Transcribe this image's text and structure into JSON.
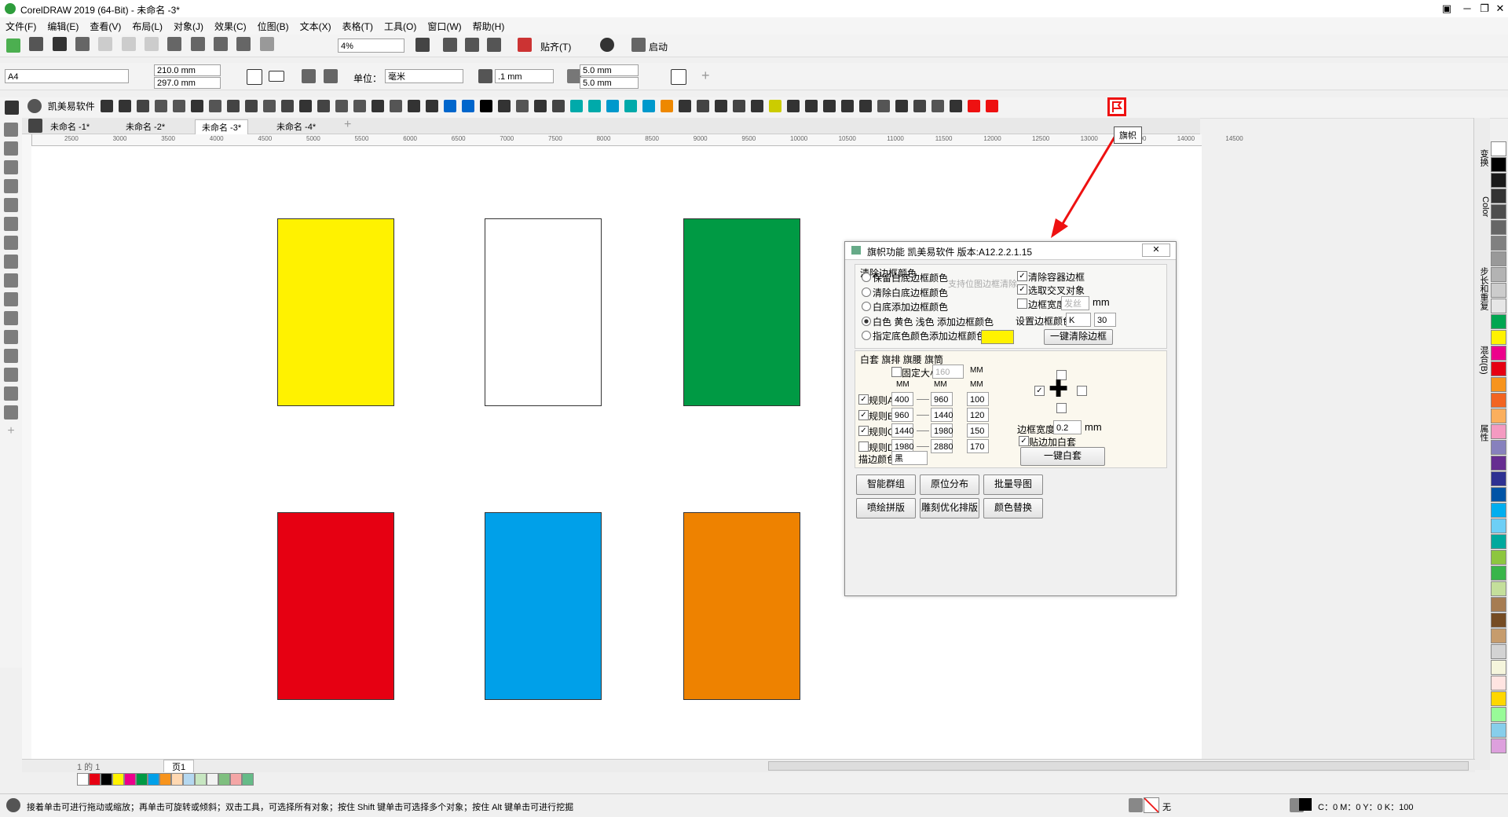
{
  "window": {
    "title": "CorelDRAW 2019 (64-Bit) - 未命名 -3*"
  },
  "menu": [
    "文件(F)",
    "编辑(E)",
    "查看(V)",
    "布局(L)",
    "对象(J)",
    "效果(C)",
    "位图(B)",
    "文本(X)",
    "表格(T)",
    "工具(O)",
    "窗口(W)",
    "帮助(H)"
  ],
  "toolbar1": {
    "zoom": "4%",
    "snap": "贴齐(T)",
    "launch": "启动"
  },
  "propbar": {
    "page_size": "A4",
    "width": "210.0 mm",
    "height": "297.0 mm",
    "unit_label": "单位：",
    "unit": "毫米",
    "nudge": ".1 mm",
    "dup_x": "5.0 mm",
    "dup_y": "5.0 mm"
  },
  "plugin_bar": {
    "brand": "凯美易软件",
    "tooltip": "旗帜"
  },
  "tabs": [
    "未命名 -1*",
    "未命名 -2*",
    "未命名 -3*",
    "未命名 -4*"
  ],
  "ruler_h": [
    "2500",
    "3000",
    "3500",
    "4000",
    "4500",
    "5000",
    "5500",
    "6000",
    "6500",
    "7000",
    "7500",
    "8000",
    "8500",
    "9000",
    "9500",
    "10000",
    "10500",
    "11000",
    "11500",
    "12000",
    "12500",
    "13000",
    "13500",
    "14000",
    "14500"
  ],
  "shapes": [
    {
      "color": "#fff200"
    },
    {
      "color": "#ffffff"
    },
    {
      "color": "#009a44"
    },
    {
      "color": "#e60012"
    },
    {
      "color": "#00a0e9"
    },
    {
      "color": "#ee8200"
    }
  ],
  "dialog": {
    "title": "旗帜功能  凯美易软件  版本:A12.2.2.1.15",
    "close": "✕",
    "group1_title": "清除边框颜色",
    "radio_options": [
      "保留白底边框颜色",
      "清除白底边框颜色",
      "白底添加边框颜色",
      "白色 黄色 浅色 添加边框颜色",
      "指定底色颜色添加边框颜色"
    ],
    "hint": "支持位图边框清除",
    "chk_clear_container": "清除容器边框",
    "chk_select_cross": "选取交叉对象",
    "chk_border_width": "边框宽度",
    "border_width_val": "发丝",
    "mm": "mm",
    "set_border_color": "设置边框颜色",
    "border_color_val": "K",
    "border_color_num": "30",
    "one_click_clear": "一键清除边框",
    "group2_title": "白套 旗排 旗腰 旗筒",
    "fixed_size": "固定大小",
    "fixed_val": "160",
    "MM": "MM",
    "rules": [
      {
        "label": "规则A",
        "a": "400",
        "b": "960",
        "c": "100",
        "checked": true
      },
      {
        "label": "规则B",
        "a": "960",
        "b": "1440",
        "c": "120",
        "checked": true
      },
      {
        "label": "规则C",
        "a": "1440",
        "b": "1980",
        "c": "150",
        "checked": true
      },
      {
        "label": "规则D",
        "a": "1980",
        "b": "2880",
        "c": "170",
        "checked": false
      }
    ],
    "stroke_color_label": "描边颜色",
    "stroke_color_val": "黑",
    "edge_width_label": "边框宽度",
    "edge_width_val": "0.2",
    "edge_mm": "mm",
    "chk_add_white": "贴边加白套",
    "one_click_white": "一键白套",
    "buttons": [
      "智能群组",
      "原位分布",
      "批量导图",
      "喷绘拼版",
      "雕刻优化排版",
      "颜色替换"
    ]
  },
  "page_nav": {
    "count": "1 的 1",
    "page": "页1"
  },
  "status": {
    "hint": "接着单击可进行拖动或缩放；再单击可旋转或倾斜；双击工具，可选择所有对象；按住 Shift 键单击可选择多个对象；按住 Alt 键单击可进行挖掘",
    "fill": "无",
    "outline": "C：0 M：0 Y：0 K：100"
  },
  "side_tabs": [
    "变换",
    "Color",
    "步长和重复",
    "混合(B)",
    "属性"
  ],
  "palette": [
    "#ffffff",
    "#000000",
    "#1a1a1a",
    "#333333",
    "#4d4d4d",
    "#666666",
    "#808080",
    "#999999",
    "#b3b3b3",
    "#cccccc",
    "#e6e6e6",
    "#00a651",
    "#fff200",
    "#ec008c",
    "#e60012",
    "#f7941d",
    "#f26522",
    "#fbaf5d",
    "#f49ac1",
    "#8781bd",
    "#662d91",
    "#2e3192",
    "#0054a6",
    "#00aeef",
    "#6dcff6",
    "#00a99d",
    "#8dc63f",
    "#39b54a",
    "#c4df9b",
    "#a67c52",
    "#754c24",
    "#c69c6d",
    "#d3d3d3",
    "#f5f5dc",
    "#ffe4e1",
    "#ffd700",
    "#98fb98",
    "#87ceeb",
    "#dda0dd"
  ],
  "bottom_palette": [
    "#ffffff",
    "#e60012",
    "#000000",
    "#fff200",
    "#ec008c",
    "#009a44",
    "#00a0e9",
    "#f7941d",
    "#ffd8b1",
    "#b5d8f0",
    "#c7e6c1",
    "#f2f2f2",
    "#7fbf7f",
    "#f4a6a6",
    "#66bb88"
  ]
}
